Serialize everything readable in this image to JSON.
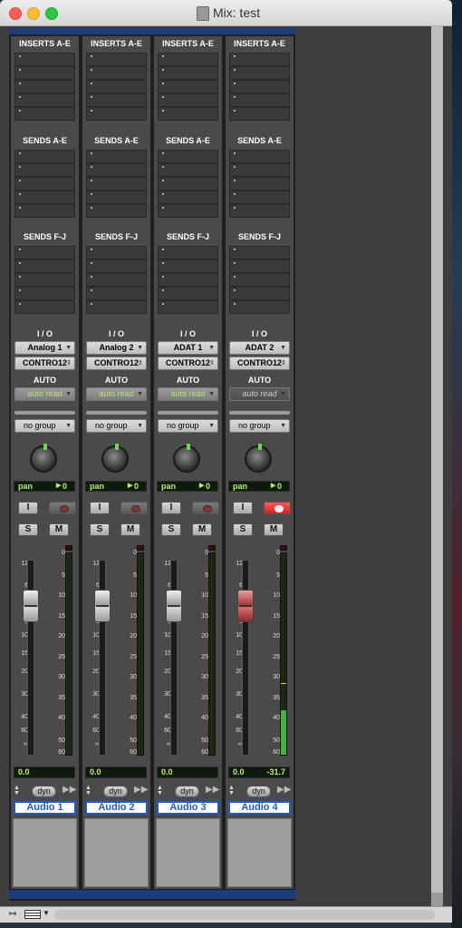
{
  "window": {
    "title": "Mix: test"
  },
  "sections": {
    "inserts": "INSERTS A-E",
    "sends_ae": "SENDS A-E",
    "sends_fj": "SENDS F-J",
    "io": "I / O",
    "auto": "AUTO"
  },
  "colors": {
    "accent": "#1d5bd6",
    "meter_green": "#3fb53f",
    "readout_green": "#b6f05e",
    "rec_armed": "#e52b2b"
  },
  "tracks": [
    {
      "name": "Audio 1",
      "input": "Analog 1",
      "output": "CONTRO12",
      "automation": "auto read",
      "group": "no group",
      "pan_label": "pan",
      "pan_value": "0",
      "input_btn": "I",
      "solo": "S",
      "mute": "M",
      "dyn": "dyn",
      "volume": "0.0",
      "peak": "",
      "rec_armed": false,
      "meter_level": 0,
      "meter_peak": 0,
      "auto_active": true
    },
    {
      "name": "Audio 2",
      "input": "Analog 2",
      "output": "CONTRO12",
      "automation": "auto read",
      "group": "no group",
      "pan_label": "pan",
      "pan_value": "0",
      "input_btn": "I",
      "solo": "S",
      "mute": "M",
      "dyn": "dyn",
      "volume": "0.0",
      "peak": "",
      "rec_armed": false,
      "meter_level": 0,
      "meter_peak": 0,
      "auto_active": true
    },
    {
      "name": "Audio 3",
      "input": "ADAT 1",
      "output": "CONTRO12",
      "automation": "auto read",
      "group": "no group",
      "pan_label": "pan",
      "pan_value": "0",
      "input_btn": "I",
      "solo": "S",
      "mute": "M",
      "dyn": "dyn",
      "volume": "0.0",
      "peak": "",
      "rec_armed": false,
      "meter_level": 0,
      "meter_peak": 0,
      "auto_active": true
    },
    {
      "name": "Audio 4",
      "input": "ADAT 2",
      "output": "CONTRO12",
      "automation": "auto read",
      "group": "no group",
      "pan_label": "pan",
      "pan_value": "0",
      "input_btn": "I",
      "solo": "S",
      "mute": "M",
      "dyn": "dyn",
      "volume": "0.0",
      "peak": "-31.7",
      "rec_armed": true,
      "meter_level": 0.22,
      "meter_peak": 0.35,
      "auto_active": false
    }
  ],
  "fader_scale": [
    "12",
    "6",
    "5",
    "0",
    "5",
    "10",
    "15",
    "20",
    "30",
    "40",
    "60",
    "∞"
  ],
  "meter_scale": [
    "0",
    "5",
    "10",
    "15",
    "20",
    "25",
    "30",
    "35",
    "40",
    "50",
    "60"
  ]
}
